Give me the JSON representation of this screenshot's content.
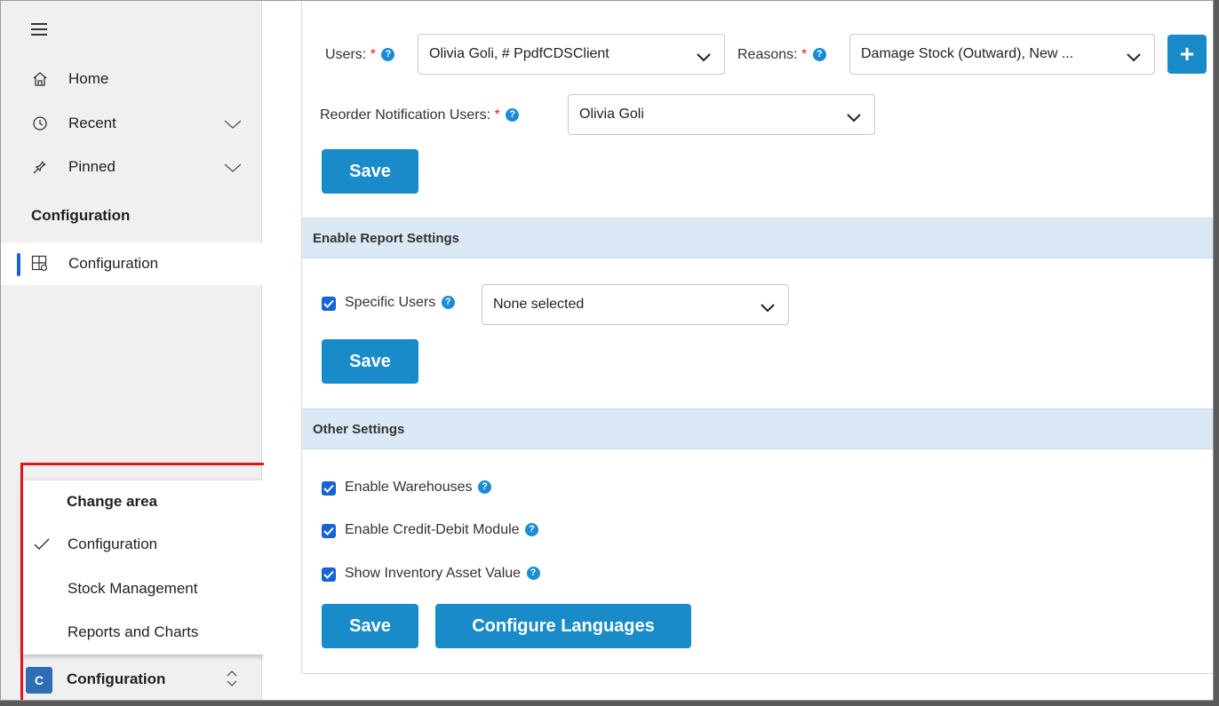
{
  "sidebar": {
    "items": [
      {
        "label": "Home",
        "icon": "home-icon"
      },
      {
        "label": "Recent",
        "icon": "clock-icon"
      },
      {
        "label": "Pinned",
        "icon": "pin-icon"
      }
    ],
    "section_title": "Configuration",
    "active_item": {
      "label": "Configuration",
      "icon": "grid-settings-icon"
    }
  },
  "area_popup": {
    "title": "Change area",
    "items": [
      {
        "label": "Configuration",
        "selected": true
      },
      {
        "label": "Stock Management",
        "selected": false
      },
      {
        "label": "Reports and Charts",
        "selected": false
      }
    ]
  },
  "area_switch": {
    "badge": "C",
    "label": "Configuration"
  },
  "form": {
    "users_label": "Users:",
    "users_value": "Olivia Goli, # PpdfCDSClient",
    "reasons_label": "Reasons:",
    "reasons_value": "Damage Stock (Outward), New ...",
    "plus_label": "+",
    "reorder_label": "Reorder Notification Users:",
    "reorder_value": "Olivia Goli",
    "required_mark": "*",
    "help_mark": "?",
    "save_label": "Save"
  },
  "report_settings": {
    "title": "Enable Report Settings",
    "specific_users_label": "Specific Users",
    "specific_users_checked": true,
    "specific_users_value": "None selected",
    "save_label": "Save"
  },
  "other_settings": {
    "title": "Other Settings",
    "options": [
      {
        "label": "Enable Warehouses",
        "checked": true
      },
      {
        "label": "Enable Credit-Debit Module",
        "checked": true
      },
      {
        "label": "Show Inventory Asset Value",
        "checked": true
      }
    ],
    "save_label": "Save",
    "configure_languages_label": "Configure Languages"
  },
  "colors": {
    "primary_button": "#1a8bc9",
    "checkbox": "#1664d4",
    "required": "#e0151c",
    "section_bar": "#dbe9f6",
    "highlight": "#e0151c",
    "active_indicator": "#1664d4"
  }
}
